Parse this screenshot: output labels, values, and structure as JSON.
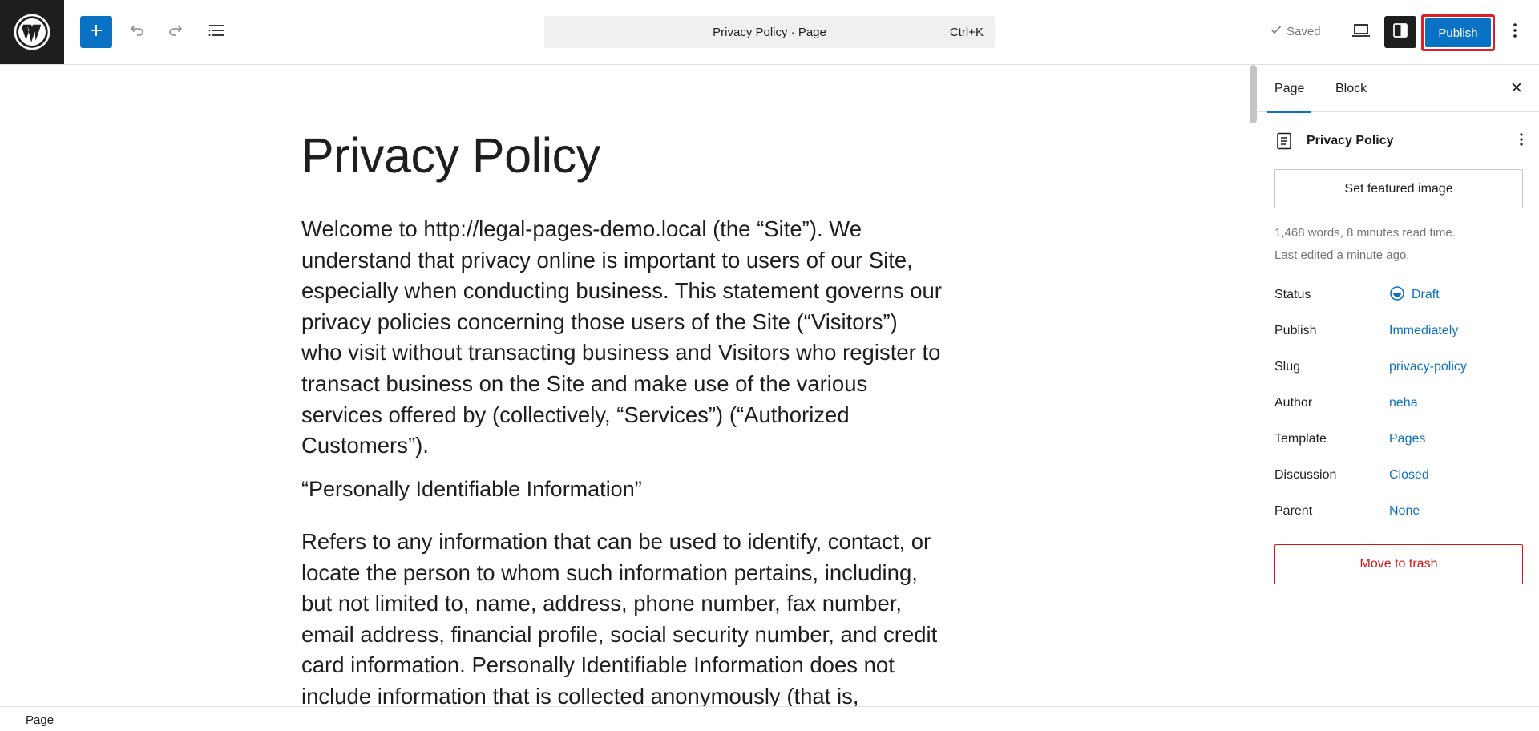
{
  "header": {
    "command_title": "Privacy Policy · Page",
    "command_shortcut": "Ctrl+K",
    "saved_label": "Saved",
    "publish_label": "Publish"
  },
  "editor": {
    "title": "Privacy Policy",
    "paragraph1": "Welcome to http://legal-pages-demo.local (the “Site”). We understand that privacy online is important to users of our Site, especially when conducting business. This statement governs our privacy policies concerning those users of the Site (“Visitors”) who visit without transacting business and Visitors who register to transact business on the Site and make use of the various services offered by (collectively, “Services”) (“Authorized Customers”).",
    "heading1": "“Personally Identifiable Information”",
    "paragraph2": "Refers to any information that can be used to identify, contact, or locate the person to whom such information pertains, including, but not limited to, name, address, phone number, fax number, email address, financial profile, social security number, and credit card information. Personally Identifiable Information does not include information that is collected anonymously (that is,"
  },
  "sidebar": {
    "tab_page": "Page",
    "tab_block": "Block",
    "doc_title": "Privacy Policy",
    "featured_image_label": "Set featured image",
    "meta_words": "1,468 words, 8 minutes read time.",
    "meta_edited": "Last edited a minute ago.",
    "rows": [
      {
        "label": "Status",
        "value": "Draft"
      },
      {
        "label": "Publish",
        "value": "Immediately"
      },
      {
        "label": "Slug",
        "value": "privacy-policy"
      },
      {
        "label": "Author",
        "value": "neha"
      },
      {
        "label": "Template",
        "value": "Pages"
      },
      {
        "label": "Discussion",
        "value": "Closed"
      },
      {
        "label": "Parent",
        "value": "None"
      }
    ],
    "trash_label": "Move to trash"
  },
  "footer": {
    "breadcrumb": "Page"
  },
  "colors": {
    "accent": "#0a72c4",
    "highlight_outline": "#e11d26",
    "danger": "#cc1818",
    "logo_bg": "#1e1e1e"
  },
  "icons": [
    "wordpress-logo-icon",
    "plus-icon",
    "undo-icon",
    "redo-icon",
    "document-overview-icon",
    "check-icon",
    "desktop-preview-icon",
    "sidebar-toggle-icon",
    "more-vertical-icon",
    "close-icon",
    "page-icon",
    "draft-status-icon"
  ]
}
